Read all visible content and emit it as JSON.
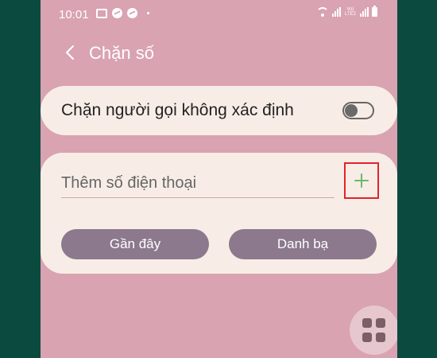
{
  "status_bar": {
    "time": "10:01",
    "network_label": "Vo) LTE2"
  },
  "header": {
    "title": "Chặn số"
  },
  "block_unknown": {
    "label": "Chặn người gọi không xác định",
    "enabled": false
  },
  "add_number": {
    "placeholder": "Thêm số điện thoại",
    "value": ""
  },
  "buttons": {
    "recent_label": "Gần đây",
    "contacts_label": "Danh bạ"
  },
  "colors": {
    "screen_background": "#d9a3b1",
    "card_background": "#f8ede6",
    "pill_button": "#8c798d",
    "add_icon": "#6bb86a",
    "highlight_box": "#e2232a",
    "outer_background": "#0b4a3e"
  },
  "icons": {
    "back": "chevron-left-icon",
    "add": "plus-icon",
    "fab": "grid-icon"
  }
}
